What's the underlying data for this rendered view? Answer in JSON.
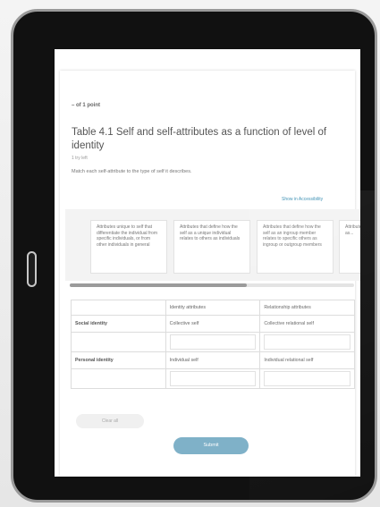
{
  "question": {
    "points_label": "– of 1 point",
    "title": "Table 4.1 Self and self-attributes as a function of level of identity",
    "subtitle": "1 try left",
    "instruction": "Match each self-attribute to the type of self it describes.",
    "show_link": "Show in Accessibility"
  },
  "chips": [
    "Attributes unique to self that differentiate the individual from specific individuals, or from other individuals in general",
    "Attributes that define how the self as a unique individual relates to others as individuals",
    "Attributes that define how the self as an ingroup member relates to specific others as ingroup or outgroup members",
    "Attributes that define the self as..."
  ],
  "table": {
    "columns": [
      "",
      "Identity attributes",
      "Relationship attributes"
    ],
    "rows": [
      {
        "label": "Social identity",
        "cells": [
          "Collective self",
          "Collective relational self"
        ]
      },
      {
        "label": "Personal identity",
        "cells": [
          "Individual self",
          "Individual relational self"
        ]
      }
    ]
  },
  "buttons": {
    "clear": "Clear all",
    "submit": "Submit"
  },
  "colors": {
    "accent": "#7fb1c8",
    "link": "#3a8fb3",
    "bezel": "#111111"
  }
}
